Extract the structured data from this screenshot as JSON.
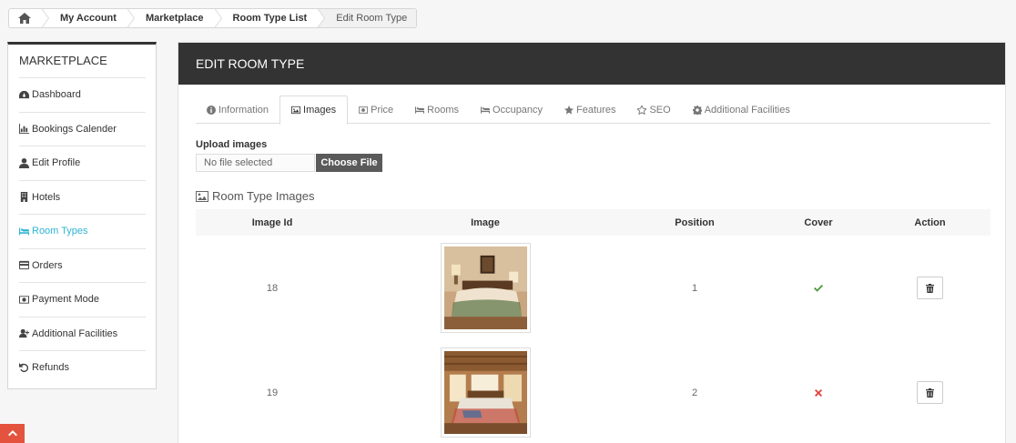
{
  "breadcrumb": {
    "items": [
      "My Account",
      "Marketplace",
      "Room Type List"
    ],
    "current": "Edit Room Type"
  },
  "sidebar": {
    "title": "MARKETPLACE",
    "items": [
      {
        "label": "Dashboard",
        "icon": "dashboard-icon"
      },
      {
        "label": "Bookings Calender",
        "icon": "bar-chart-icon"
      },
      {
        "label": "Edit Profile",
        "icon": "user-icon"
      },
      {
        "label": "Hotels",
        "icon": "building-icon"
      },
      {
        "label": "Room Types",
        "icon": "bed-icon",
        "active": true
      },
      {
        "label": "Orders",
        "icon": "credit-card-icon"
      },
      {
        "label": "Payment Mode",
        "icon": "money-icon"
      },
      {
        "label": "Additional Facilities",
        "icon": "user-plus-icon"
      },
      {
        "label": "Refunds",
        "icon": "undo-icon"
      }
    ],
    "accent": "#2fb5d2"
  },
  "panel": {
    "title": "EDIT ROOM TYPE"
  },
  "tabs": [
    {
      "label": "Information",
      "icon": "info-icon"
    },
    {
      "label": "Images",
      "icon": "image-icon",
      "active": true
    },
    {
      "label": "Price",
      "icon": "money-icon"
    },
    {
      "label": "Rooms",
      "icon": "bed-icon"
    },
    {
      "label": "Occupancy",
      "icon": "bed-icon"
    },
    {
      "label": "Features",
      "icon": "star-icon"
    },
    {
      "label": "SEO",
      "icon": "star-outline-icon"
    },
    {
      "label": "Additional Facilities",
      "icon": "gear-icon"
    }
  ],
  "upload": {
    "label": "Upload images",
    "file_text": "No file selected",
    "button": "Choose File"
  },
  "images_section": {
    "title": "Room Type Images",
    "columns": [
      "Image Id",
      "Image",
      "Position",
      "Cover",
      "Action"
    ],
    "rows": [
      {
        "id": "18",
        "position": "1",
        "cover": true
      },
      {
        "id": "19",
        "position": "2",
        "cover": false
      }
    ]
  },
  "colors": {
    "header_bg": "#333333",
    "check": "#4a9a3a",
    "cross": "#e0403a",
    "scroll_top": "#e4533d"
  }
}
